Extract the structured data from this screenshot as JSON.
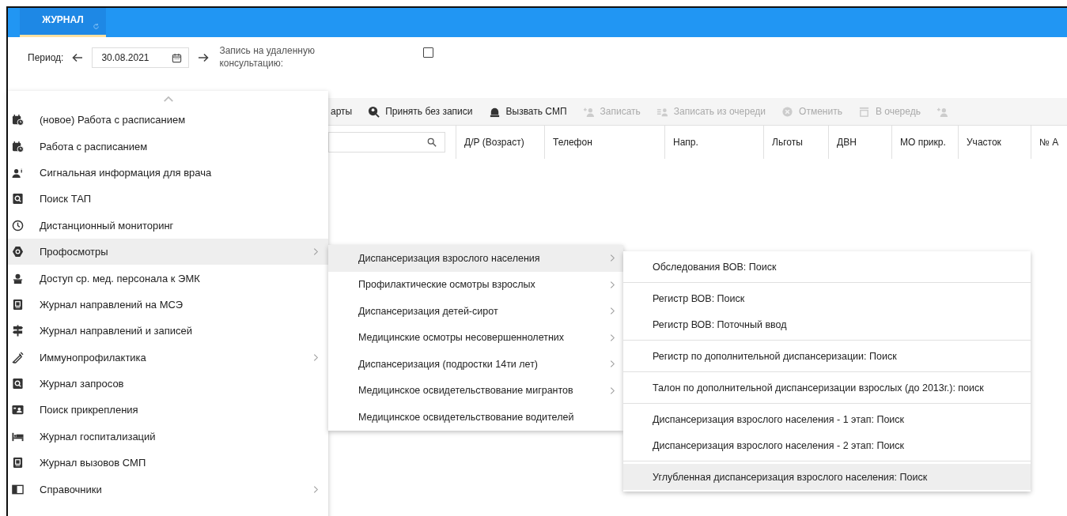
{
  "header": {
    "tabs": [
      {
        "label": "ЖУРНАЛ",
        "selected": true
      }
    ]
  },
  "filter": {
    "period_label": "Период:",
    "date": "30.08.2021",
    "remote_label": "Запись на удаленную консультацию:",
    "remote_checked": false
  },
  "toolbar": [
    {
      "label": "арты",
      "disabled": false
    },
    {
      "label": "Принять без записи",
      "disabled": false
    },
    {
      "label": "Вызвать СМП",
      "disabled": false
    },
    {
      "label": "Записать",
      "disabled": true
    },
    {
      "label": "Записать из очереди",
      "disabled": true
    },
    {
      "label": "Отменить",
      "disabled": true
    },
    {
      "label": "В очередь",
      "disabled": true
    },
    {
      "disabled": true
    }
  ],
  "table": {
    "columns": [
      "Д/Р (Возраст)",
      "Телефон",
      "Напр.",
      "Льготы",
      "ДВН",
      "МО прикр.",
      "Участок",
      "№ А"
    ]
  },
  "menu": {
    "items": [
      {
        "label": "(новое) Работа с расписанием",
        "has_submenu": false,
        "selected": false
      },
      {
        "label": "Работа с расписанием",
        "has_submenu": false,
        "selected": false
      },
      {
        "label": "Сигнальная информация для врача",
        "has_submenu": false,
        "selected": false
      },
      {
        "label": "Поиск ТАП",
        "has_submenu": false,
        "selected": false
      },
      {
        "label": "Дистанционный мониторинг",
        "has_submenu": false,
        "selected": false
      },
      {
        "label": "Профосмотры",
        "has_submenu": true,
        "selected": true
      },
      {
        "label": "Доступ ср. мед. персонала к ЭМК",
        "has_submenu": false,
        "selected": false
      },
      {
        "label": "Журнал направлений на МСЭ",
        "has_submenu": false,
        "selected": false
      },
      {
        "label": "Журнал направлений и записей",
        "has_submenu": false,
        "selected": false
      },
      {
        "label": "Иммунопрофилактика",
        "has_submenu": true,
        "selected": false
      },
      {
        "label": "Журнал запросов",
        "has_submenu": false,
        "selected": false
      },
      {
        "label": "Поиск прикрепления",
        "has_submenu": false,
        "selected": false
      },
      {
        "label": "Журнал госпитализаций",
        "has_submenu": false,
        "selected": false
      },
      {
        "label": "Журнал вызовов СМП",
        "has_submenu": false,
        "selected": false
      },
      {
        "label": "Справочники",
        "has_submenu": true,
        "selected": false
      }
    ]
  },
  "submenu": {
    "items": [
      {
        "label": "Диспансеризация взрослого населения",
        "has_submenu": true,
        "selected": true
      },
      {
        "label": "Профилактические осмотры взрослых",
        "has_submenu": true,
        "selected": false
      },
      {
        "label": "Диспансеризация детей-сирот",
        "has_submenu": true,
        "selected": false
      },
      {
        "label": "Медицинские осмотры несовершеннолетних",
        "has_submenu": true,
        "selected": false
      },
      {
        "label": "Диспансеризация (подростки 14ти лет)",
        "has_submenu": true,
        "selected": false
      },
      {
        "label": "Медицинское освидетельствование мигрантов",
        "has_submenu": true,
        "selected": false
      },
      {
        "label": "Медицинское освидетельствование водителей",
        "has_submenu": false,
        "selected": false
      }
    ]
  },
  "submenu2": {
    "groups": [
      [
        {
          "label": "Обследования ВОВ: Поиск",
          "selected": false
        }
      ],
      [
        {
          "label": "Регистр ВОВ: Поиск",
          "selected": false
        },
        {
          "label": "Регистр ВОВ: Поточный ввод",
          "selected": false
        }
      ],
      [
        {
          "label": "Регистр по дополнительной диспансеризации: Поиск",
          "selected": false
        }
      ],
      [
        {
          "label": "Талон по дополнительной диспансеризации взрослых (до 2013г.): поиск",
          "selected": false
        }
      ],
      [
        {
          "label": "Диспансеризация взрослого населения - 1 этап: Поиск",
          "selected": false
        },
        {
          "label": "Диспансеризация взрослого населения - 2 этап: Поиск",
          "selected": false
        }
      ],
      [
        {
          "label": "Углубленная диспансеризация взрослого населения: Поиск",
          "selected": true
        }
      ]
    ]
  }
}
